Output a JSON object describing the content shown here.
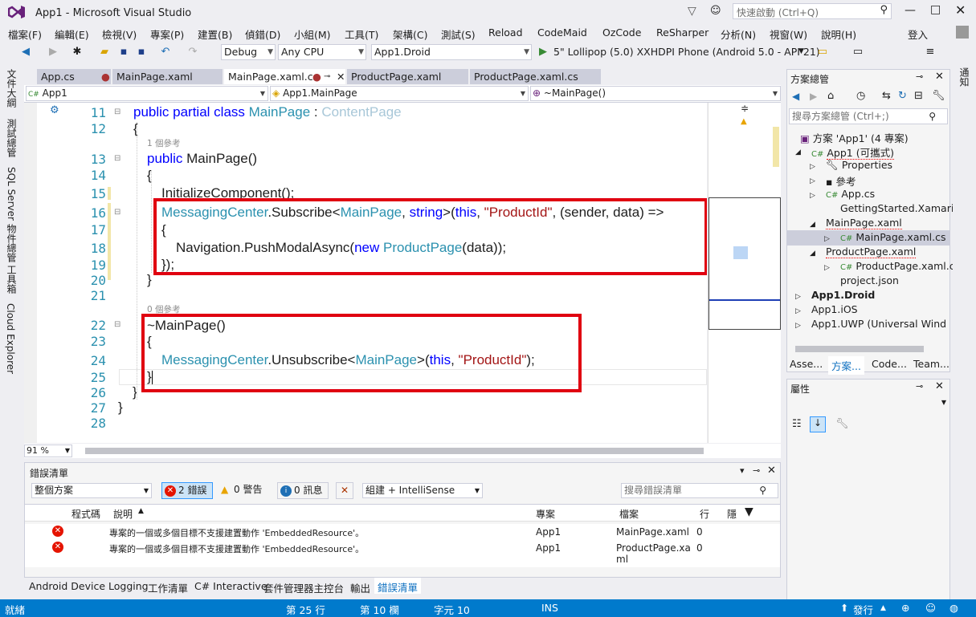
{
  "window": {
    "title": "App1 - Microsoft Visual Studio",
    "quick_launch_placeholder": "快速啟動 (Ctrl+Q)"
  },
  "menu": [
    "檔案(F)",
    "編輯(E)",
    "檢視(V)",
    "專案(P)",
    "建置(B)",
    "偵錯(D)",
    "小組(M)",
    "工具(T)",
    "架構(C)",
    "測試(S)",
    "Reload",
    "CodeMaid",
    "OzCode",
    "ReSharper",
    "分析(N)",
    "視窗(W)",
    "說明(H)"
  ],
  "signin": "登入",
  "toolbar": {
    "config": "Debug",
    "platform": "Any CPU",
    "project": "App1.Droid",
    "run_target": "5\" Lollipop (5.0) XXHDPI Phone (Android 5.0 - API 21)"
  },
  "left_tabs": [
    "文件大綱",
    "測試總管",
    "SQL Server 物件總管",
    "工具箱",
    "Cloud Explorer"
  ],
  "doc_tabs": [
    "App.cs",
    "MainPage.xaml",
    "MainPage.xaml.cs",
    "ProductPage.xaml",
    "ProductPage.xaml.cs"
  ],
  "nav": {
    "project": "App1",
    "class": "App1.MainPage",
    "member": "~MainPage()"
  },
  "code": {
    "line_numbers": [
      "11",
      "12",
      "13",
      "14",
      "15",
      "16",
      "17",
      "18",
      "19",
      "20",
      "21",
      "22",
      "23",
      "24",
      "25",
      "26",
      "27",
      "28"
    ],
    "ref_hint_1": "1 個參考",
    "ref_hint_2": "0 個參考",
    "l11": {
      "kw": "public partial class ",
      "name": "MainPage",
      "sep": " : ",
      "base": "ContentPage"
    },
    "l12": "{",
    "l13": {
      "kw": "public ",
      "name": "MainPage()"
    },
    "l14": "{",
    "l15": "InitializeComponent();",
    "l16": {
      "t1": "MessagingCenter",
      "t2": ".Subscribe<",
      "t3": "MainPage",
      "t4": ", ",
      "t5": "string",
      "t6": ">(",
      "t7": "this",
      "t8": ", ",
      "t9": "\"ProductId\"",
      "t10": ", (sender, data) =>"
    },
    "l17": "{",
    "l18": {
      "t1": "Navigation.PushModalAsync(",
      "t2": "new ",
      "t3": "ProductPage",
      "t4": "(data));"
    },
    "l19": "});",
    "l20": "}",
    "l22": "~MainPage()",
    "l23": "{",
    "l24": {
      "t1": "MessagingCenter",
      "t2": ".Unsubscribe<",
      "t3": "MainPage",
      "t4": ">(",
      "t5": "this",
      "t6": ", ",
      "t7": "\"ProductId\"",
      "t8": ");"
    },
    "l25": "}",
    "l26": "}",
    "l27": "}"
  },
  "zoom": "91 %",
  "error_list": {
    "title": "錯誤清單",
    "scope": "整個方案",
    "errors_btn": "2 錯誤",
    "warnings_btn": "0 警告",
    "messages_btn": "0 訊息",
    "build_filter": "組建 + IntelliSense",
    "search_placeholder": "搜尋錯誤清單",
    "columns": [
      "程式碼",
      "說明",
      "專案",
      "檔案",
      "行",
      "隱"
    ],
    "rows": [
      {
        "desc": "專案的一個或多個目標不支援建置動作 'EmbeddedResource'。",
        "project": "App1",
        "file": "MainPage.xaml",
        "line": "0"
      },
      {
        "desc": "專案的一個或多個目標不支援建置動作 'EmbeddedResource'。",
        "project": "App1",
        "file": "ProductPage.xa",
        "file2": "ml",
        "line": "0"
      }
    ]
  },
  "bottom_tabs": [
    "Android Device Logging",
    "工作清單",
    "C# Interactive",
    "套件管理器主控台",
    "輸出",
    "錯誤清單"
  ],
  "status": {
    "ready": "就緒",
    "line": "第 25 行",
    "col": "第 10 欄",
    "ch": "字元 10",
    "ins": "INS",
    "publish": "發行"
  },
  "solution": {
    "title": "方案總管",
    "search_placeholder": "搜尋方案總管 (Ctrl+;)",
    "items": [
      "方案 'App1' (4 專案)",
      "App1 (可攜式)",
      "Properties",
      "參考",
      "App.cs",
      "GettingStarted.Xamarin",
      "MainPage.xaml",
      "MainPage.xaml.cs",
      "ProductPage.xaml",
      "ProductPage.xaml.cs",
      "project.json",
      "App1.Droid",
      "App1.iOS",
      "App1.UWP (Universal Wind"
    ],
    "tabs": [
      "Asse...",
      "方案...",
      "Code...",
      "Team..."
    ]
  },
  "properties": {
    "title": "屬性"
  },
  "right_rail": "通知",
  "colors": {
    "accent": "#007acc",
    "highlight": "#e00010",
    "keyword": "#0000ff",
    "type": "#2b91af",
    "string": "#a31515"
  }
}
